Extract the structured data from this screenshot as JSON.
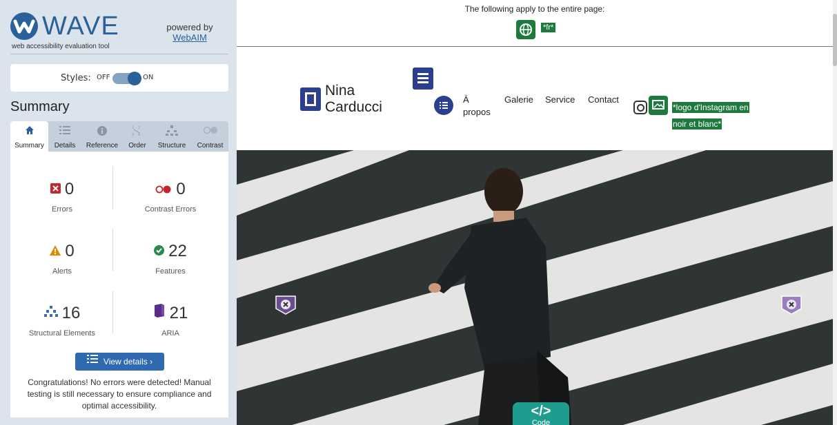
{
  "sidebar": {
    "brand_name": "WAVE",
    "tagline": "web accessibility evaluation tool",
    "powered_by": "powered by",
    "powered_link": "WebAIM",
    "styles_label": "Styles:",
    "styles_off": "OFF",
    "styles_on": "ON",
    "section_title": "Summary",
    "tabs": [
      {
        "label": "Summary",
        "icon": "home-icon"
      },
      {
        "label": "Details",
        "icon": "list-icon"
      },
      {
        "label": "Reference",
        "icon": "info-icon"
      },
      {
        "label": "Order",
        "icon": "order-icon"
      },
      {
        "label": "Structure",
        "icon": "structure-icon"
      },
      {
        "label": "Contrast",
        "icon": "contrast-icon"
      }
    ],
    "stats": {
      "errors": {
        "value": "0",
        "label": "Errors"
      },
      "contrast_errors": {
        "value": "0",
        "label": "Contrast Errors"
      },
      "alerts": {
        "value": "0",
        "label": "Alerts"
      },
      "features": {
        "value": "22",
        "label": "Features"
      },
      "structural": {
        "value": "16",
        "label": "Structural Elements"
      },
      "aria": {
        "value": "21",
        "label": "ARIA"
      }
    },
    "view_details": "View details ›",
    "congrats": "Congratulations! No errors were detected! Manual testing is still necessary to ensure compliance and optimal accessibility."
  },
  "preview": {
    "page_level_text": "The following apply to the entire page:",
    "lang_label": "*fr*",
    "site_name_line1": "Nina",
    "site_name_line2": "Carducci",
    "nav": {
      "apropos_line1": "À",
      "apropos_line2": "propos",
      "galerie": "Galerie",
      "service": "Service",
      "contact": "Contact"
    },
    "alt_text_line1": "*logo d'Instagram en",
    "alt_text_line2": "noir et blanc*",
    "code_glyph": "</>",
    "code_label": "Code"
  },
  "colors": {
    "wave_blue": "#2a6199",
    "feature_green": "#1e7a3c",
    "aria_navy": "#2a3f8f",
    "error_red": "#c0282d",
    "alert_orange": "#e08a00",
    "code_teal": "#1e9d8f"
  }
}
